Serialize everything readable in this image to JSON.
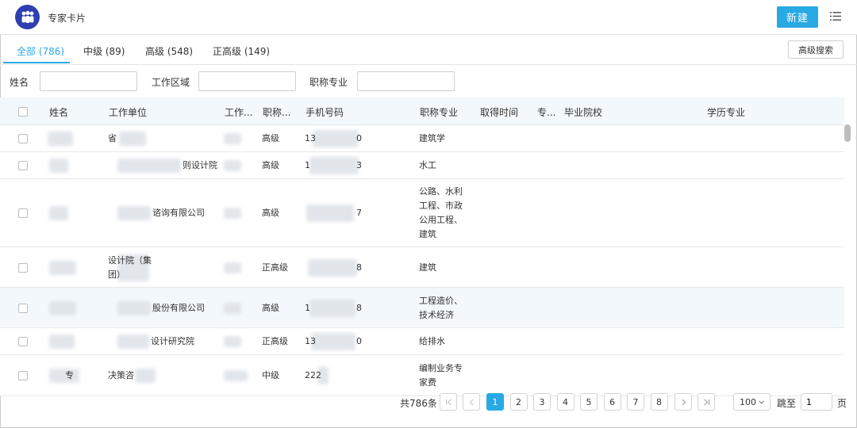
{
  "app": {
    "title": "专家卡片",
    "new_button": "新建",
    "logo_icon": "people-group-icon",
    "menu_icon": "list-icon",
    "accent_color": "#29a9e4"
  },
  "tabs": [
    {
      "label": "全部 (786)",
      "active": true
    },
    {
      "label": "中级 (89)",
      "active": false
    },
    {
      "label": "高级 (548)",
      "active": false
    },
    {
      "label": "正高级 (149)",
      "active": false
    }
  ],
  "advanced_search_label": "高级搜索",
  "filters": {
    "name_label": "姓名",
    "area_label": "工作区域",
    "major_label": "职称专业",
    "name_value": "",
    "area_value": "",
    "major_value": ""
  },
  "columns": [
    "姓名",
    "工作单位",
    "工作...",
    "职称...",
    "手机号码",
    "职称专业",
    "取得时间",
    "专...",
    "毕业院校",
    "学历专业"
  ],
  "rows": [
    {
      "name": "",
      "unit_lines": [
        "省"
      ],
      "area": "",
      "level": "高级",
      "phone": "13",
      "phone_end": "0",
      "major_lines": [
        "建筑学"
      ],
      "highlighted": false
    },
    {
      "name": "",
      "unit_lines": [
        "则设计院"
      ],
      "area": "",
      "level": "高级",
      "phone": "1",
      "phone_end": "3",
      "major_lines": [
        "水工"
      ],
      "highlighted": false
    },
    {
      "name": "",
      "unit_lines": [
        "谘询有限公司"
      ],
      "area": "",
      "level": "高级",
      "phone": "",
      "phone_end": "7",
      "major_lines": [
        "公路、水利",
        "工程、市政",
        "公用工程、",
        "建筑"
      ],
      "highlighted": false
    },
    {
      "name": "",
      "unit_lines": [
        "设计院（集",
        "团）"
      ],
      "area": "",
      "level": "正高级",
      "phone": "",
      "phone_end": "8",
      "major_lines": [
        "建筑"
      ],
      "highlighted": false
    },
    {
      "name": "",
      "unit_lines": [
        "股份有限公司"
      ],
      "area": "",
      "level": "高级",
      "phone": "1",
      "phone_end": "8",
      "major_lines": [
        "工程造价、",
        "技术经济"
      ],
      "highlighted": true
    },
    {
      "name": "",
      "unit_lines": [
        "设计研究院"
      ],
      "area": "",
      "level": "正高级",
      "phone": "13",
      "phone_end": "0",
      "major_lines": [
        "给排水"
      ],
      "highlighted": false
    },
    {
      "name": "专",
      "unit_lines": [
        "决策咨"
      ],
      "area": "",
      "level": "中级",
      "phone": "222",
      "phone_end": "",
      "major_lines": [
        "编制业务专",
        "家费"
      ],
      "highlighted": false
    }
  ],
  "pagination": {
    "total_label": "共786条",
    "pages": [
      "1",
      "2",
      "3",
      "4",
      "5",
      "6",
      "7",
      "8"
    ],
    "current_page": 1,
    "page_size": "100",
    "jump_label": "跳至",
    "jump_value": "1",
    "page_unit": "页"
  }
}
